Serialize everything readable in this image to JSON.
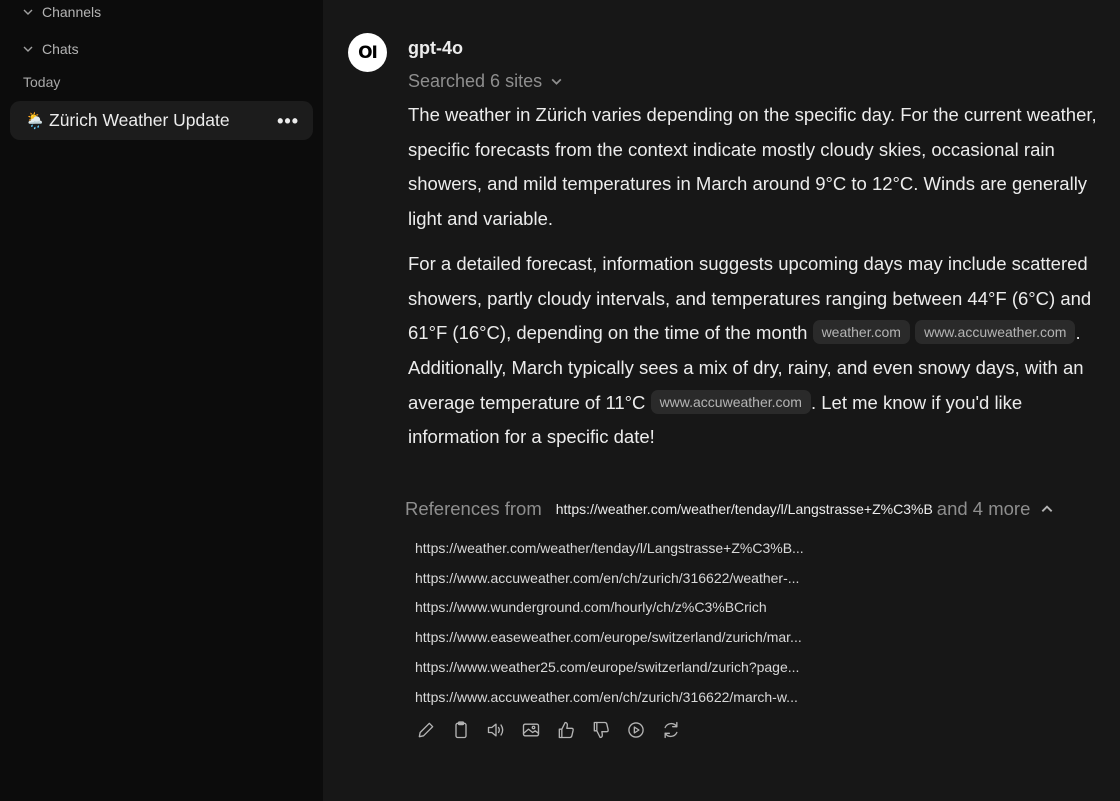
{
  "sidebar": {
    "sections": [
      {
        "label": "Channels",
        "icon": "chevron-down-icon"
      },
      {
        "label": "Chats",
        "icon": "chevron-down-icon"
      }
    ],
    "today_label": "Today",
    "chat_item": {
      "emoji": "🌦️",
      "title": "Zürich Weather Update",
      "more": "•••"
    }
  },
  "message": {
    "avatar_text": "OI",
    "model": "gpt-4o",
    "searched": "Searched 6 sites",
    "paragraph1": "The weather in Zürich varies depending on the specific day. For the current weather, specific forecasts from the context indicate mostly cloudy skies, occasional rain showers, and mild temperatures in March around 9°C to 12°C. Winds are generally light and variable.",
    "paragraph2": {
      "part1": "For a detailed forecast, information suggests upcoming days may include scattered showers, partly cloudy intervals, and temperatures ranging between 44°F (6°C) and 61°F (16°C), depending on the time of the month ",
      "cite1": "weather.com",
      "cite2": "www.accuweather.com",
      "part2": ". Additionally, March typically sees a mix of dry, rainy, and even snowy days, with an average temperature of 11°C ",
      "cite3": "www.accuweather.com",
      "part3": ". Let me know if you'd like information for a specific date!"
    },
    "references": {
      "label": "References from",
      "first": "https://weather.com/weather/tenday/l/Langstrasse+Z%C3%B",
      "more": "and 4 more",
      "items": [
        "https://weather.com/weather/tenday/l/Langstrasse+Z%C3%B...",
        "https://www.accuweather.com/en/ch/zurich/316622/weather-...",
        "https://www.wunderground.com/hourly/ch/z%C3%BCrich",
        "https://www.easeweather.com/europe/switzerland/zurich/mar...",
        "https://www.weather25.com/europe/switzerland/zurich?page...",
        "https://www.accuweather.com/en/ch/zurich/316622/march-w..."
      ]
    },
    "actions": [
      "edit-icon",
      "copy-icon",
      "read-aloud-icon",
      "image-icon",
      "thumbs-up-icon",
      "thumbs-down-icon",
      "play-icon",
      "regenerate-icon"
    ]
  }
}
